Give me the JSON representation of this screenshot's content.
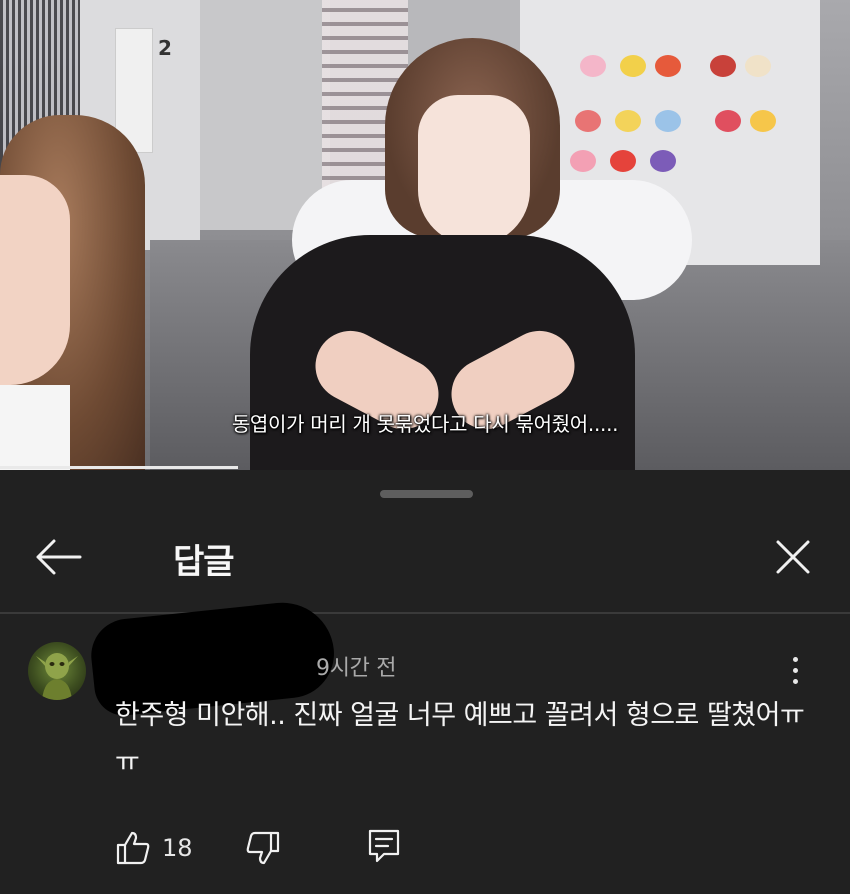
{
  "video": {
    "subtitle": "동엽이가 머리 개 못묶었다고 다시 묶어줬어.....",
    "door_number": "2",
    "progress": 0.28
  },
  "sheet": {
    "title": "답글",
    "back_icon": "arrow-left-icon",
    "close_icon": "close-icon"
  },
  "comment": {
    "time": "9시간 전",
    "text": "한주형 미안해.. 진짜 얼굴 너무 예쁘고 꼴려서 형으로 딸쳤어ㅠㅠ",
    "like_count": "18",
    "like_icon": "thumbs-up-icon",
    "dislike_icon": "thumbs-down-icon",
    "reply_icon": "reply-icon",
    "more_icon": "more-vertical-icon"
  }
}
